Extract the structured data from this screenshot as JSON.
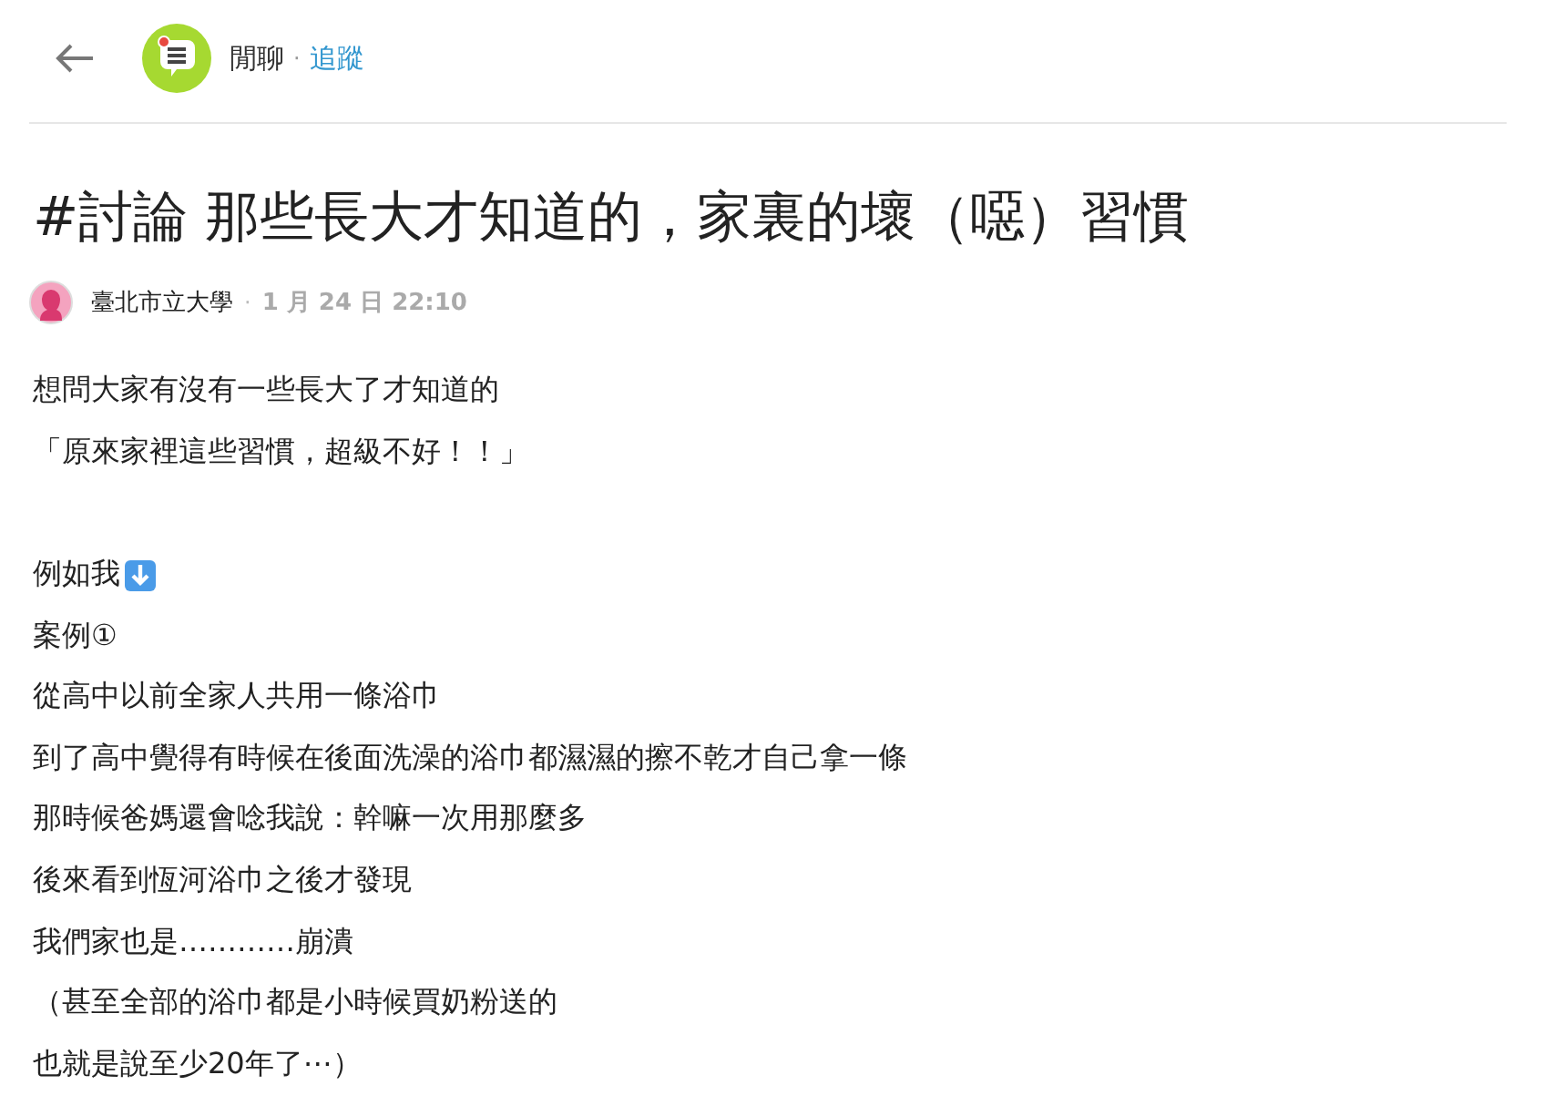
{
  "header": {
    "forum": "閒聊",
    "follow": "追蹤",
    "separator": "·",
    "has_notification": true
  },
  "post": {
    "title": "#討論 那些長大才知道的，家裏的壞（噁）習慣",
    "author": "臺北市立大學",
    "separator": "·",
    "date": "1 月 24 日 22:10",
    "paragraphs": [
      [
        {
          "kind": "text",
          "text": "想問大家有沒有一些長大了才知道的"
        },
        {
          "kind": "text",
          "text": "「原來家裡這些習慣，超級不好！！」"
        }
      ],
      [
        {
          "kind": "arrow",
          "text": "例如我"
        },
        {
          "kind": "text",
          "text": "案例①"
        },
        {
          "kind": "text",
          "text": "從高中以前全家人共用一條浴巾"
        },
        {
          "kind": "text",
          "text": "到了高中覺得有時候在後面洗澡的浴巾都濕濕的擦不乾才自己拿一條"
        },
        {
          "kind": "text",
          "text": "那時候爸媽還會唸我說：幹嘛一次用那麼多"
        },
        {
          "kind": "text",
          "text": "後來看到恆河浴巾之後才發現"
        },
        {
          "kind": "text",
          "text": "我們家也是…………崩潰"
        },
        {
          "kind": "text",
          "text": "（甚至全部的浴巾都是小時候買奶粉送的"
        },
        {
          "kind": "text",
          "text": "也就是說至少20年了⋯）"
        }
      ]
    ]
  }
}
